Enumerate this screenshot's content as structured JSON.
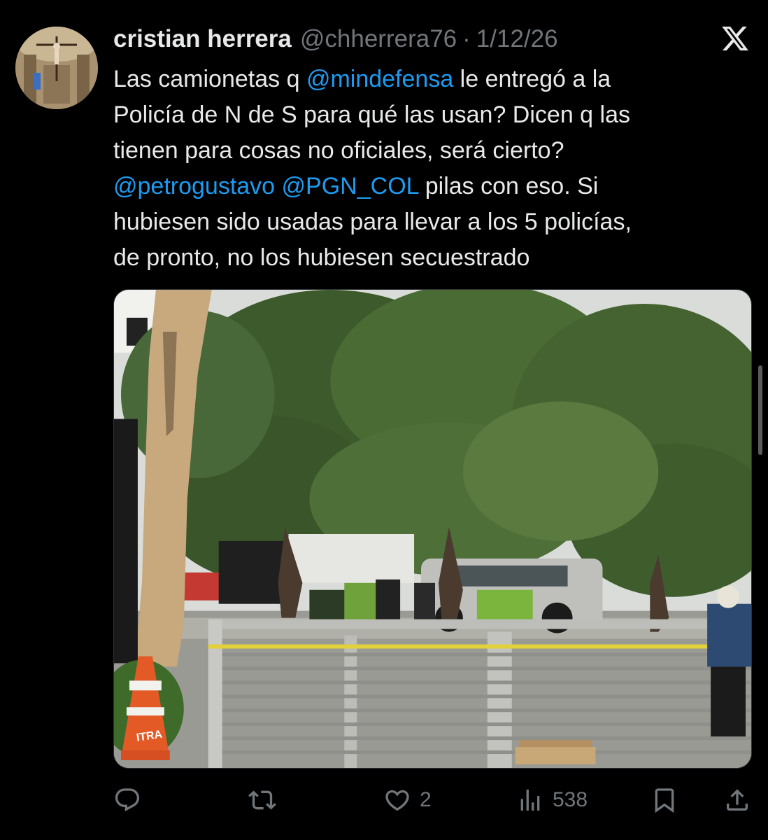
{
  "tweet": {
    "author_name": "cristian herrera",
    "handle": "@chherrera76",
    "separator": "·",
    "date": "1/12/26",
    "lines": [
      [
        {
          "t": "Las camionetas q ",
          "m": false
        },
        {
          "t": "@mindefensa",
          "m": true
        },
        {
          "t": " le entregó a la",
          "m": false
        }
      ],
      [
        {
          "t": "Policía de N de S para qué las usan? Dicen q las",
          "m": false
        }
      ],
      [
        {
          "t": "tienen para cosas no oficiales, será cierto?",
          "m": false
        }
      ],
      [
        {
          "t": "@petrogustavo",
          "m": true
        },
        {
          "t": " ",
          "m": false
        },
        {
          "t": "@PGN_COL",
          "m": true
        },
        {
          "t": " pilas con eso. Si",
          "m": false
        }
      ],
      [
        {
          "t": "hubiesen sido usadas para llevar a los 5 policías,",
          "m": false
        }
      ],
      [
        {
          "t": "de pronto, no los hubiesen secuestrado",
          "m": false
        }
      ]
    ]
  },
  "media": {
    "cone_text": "ITRA"
  },
  "actions": {
    "reply_count": "",
    "retweet_count": "",
    "like_count": "2",
    "views_count": "538"
  },
  "icons": {
    "close": "x-logo-icon",
    "reply": "reply-icon",
    "retweet": "retweet-icon",
    "like": "heart-icon",
    "views": "views-icon",
    "bookmark": "bookmark-icon",
    "share": "share-icon"
  },
  "colors": {
    "background": "#000000",
    "text": "#e7e9ea",
    "muted": "#71767b",
    "link": "#1d9bf0"
  }
}
